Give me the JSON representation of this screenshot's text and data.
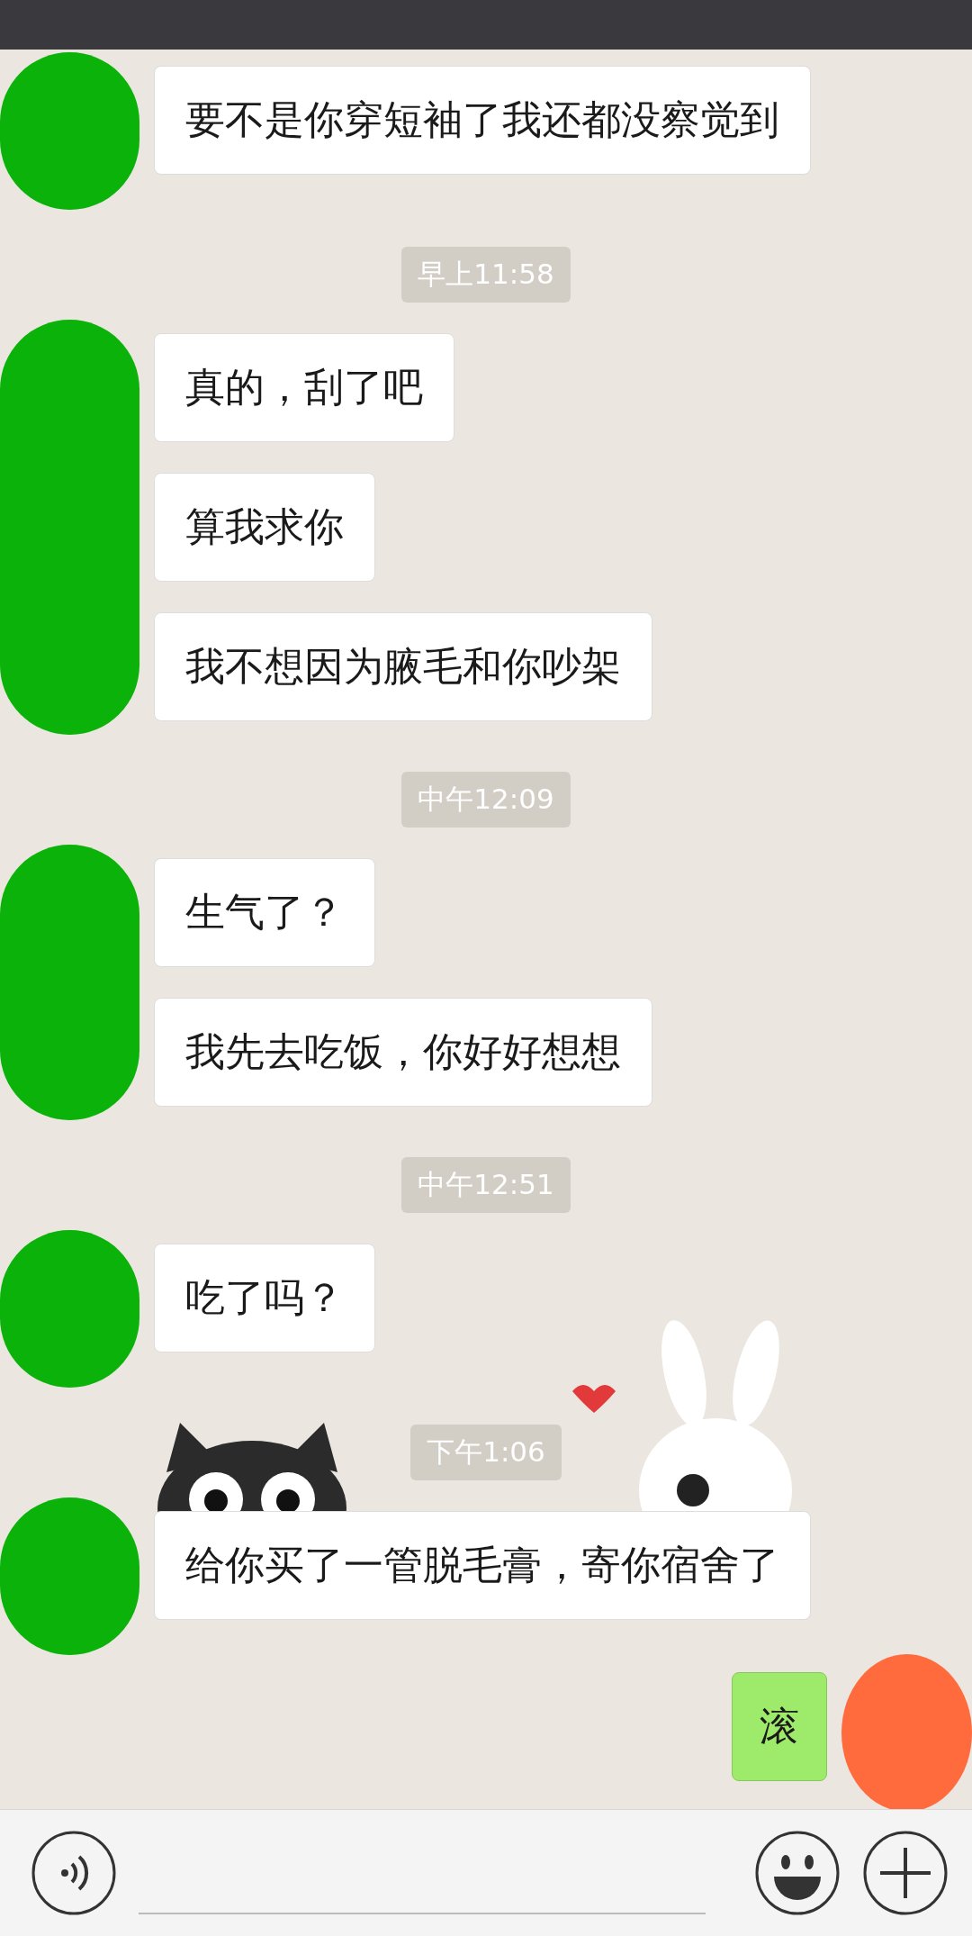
{
  "chat": [
    {
      "kind": "received",
      "color": "#0ab20a",
      "messages": [
        "要不是你穿短袖了我还都没察觉到"
      ]
    },
    {
      "kind": "time",
      "text": "早上11:58"
    },
    {
      "kind": "received",
      "color": "#0ab20a",
      "messages": [
        "真的，刮了吧",
        "算我求你",
        "我不想因为腋毛和你吵架"
      ]
    },
    {
      "kind": "time",
      "text": "中午12:09"
    },
    {
      "kind": "received",
      "color": "#0ab20a",
      "messages": [
        "生气了？",
        "我先去吃饭，你好好想想"
      ]
    },
    {
      "kind": "time",
      "text": "中午12:51"
    },
    {
      "kind": "received",
      "color": "#0ab20a",
      "messages": [
        "吃了吗？"
      ]
    },
    {
      "kind": "time",
      "text": "下午1:06"
    },
    {
      "kind": "received",
      "color": "#0ab20a",
      "messages": [
        "给你买了一管脱毛膏，寄你宿舍了"
      ]
    },
    {
      "kind": "sent",
      "color": "#ff6b3d",
      "messages": [
        "滚"
      ]
    }
  ]
}
